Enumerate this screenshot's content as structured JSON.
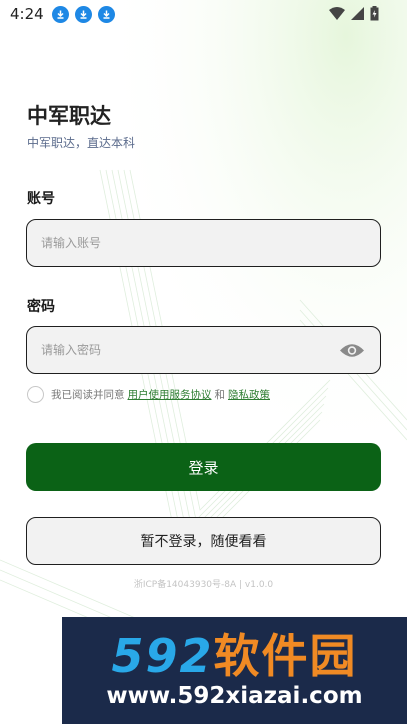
{
  "status_bar": {
    "time": "4:24",
    "download_badges": [
      "download-icon",
      "download-icon",
      "download-icon"
    ],
    "icons": [
      "wifi-icon",
      "signal-icon",
      "battery-icon"
    ]
  },
  "app": {
    "title": "中军职达",
    "subtitle": "中军职达，直达本科"
  },
  "account": {
    "label": "账号",
    "placeholder": "请输入账号",
    "value": ""
  },
  "password": {
    "label": "密码",
    "placeholder": "请输入密码",
    "value": "",
    "toggle_icon": "eye-icon"
  },
  "agreement": {
    "checked": false,
    "prefix": "我已阅读并同意",
    "terms_link": "用户使用服务协议",
    "and": "和",
    "privacy_link": "隐私政策"
  },
  "buttons": {
    "login": "登录",
    "guest": "暂不登录，随便看看"
  },
  "footer": {
    "icp": "浙ICP备14043930号-8A | v1.0.0"
  },
  "watermark": {
    "logo_num": "592",
    "logo_cn": "软件园",
    "url": "www.592xiazai.com"
  },
  "colors": {
    "primary": "#0b6216",
    "link": "#2e7d32",
    "badge": "#1e88e5",
    "watermark_bg": "#1b2a4a",
    "watermark_blue": "#29a8e8",
    "watermark_orange": "#f08a24"
  }
}
